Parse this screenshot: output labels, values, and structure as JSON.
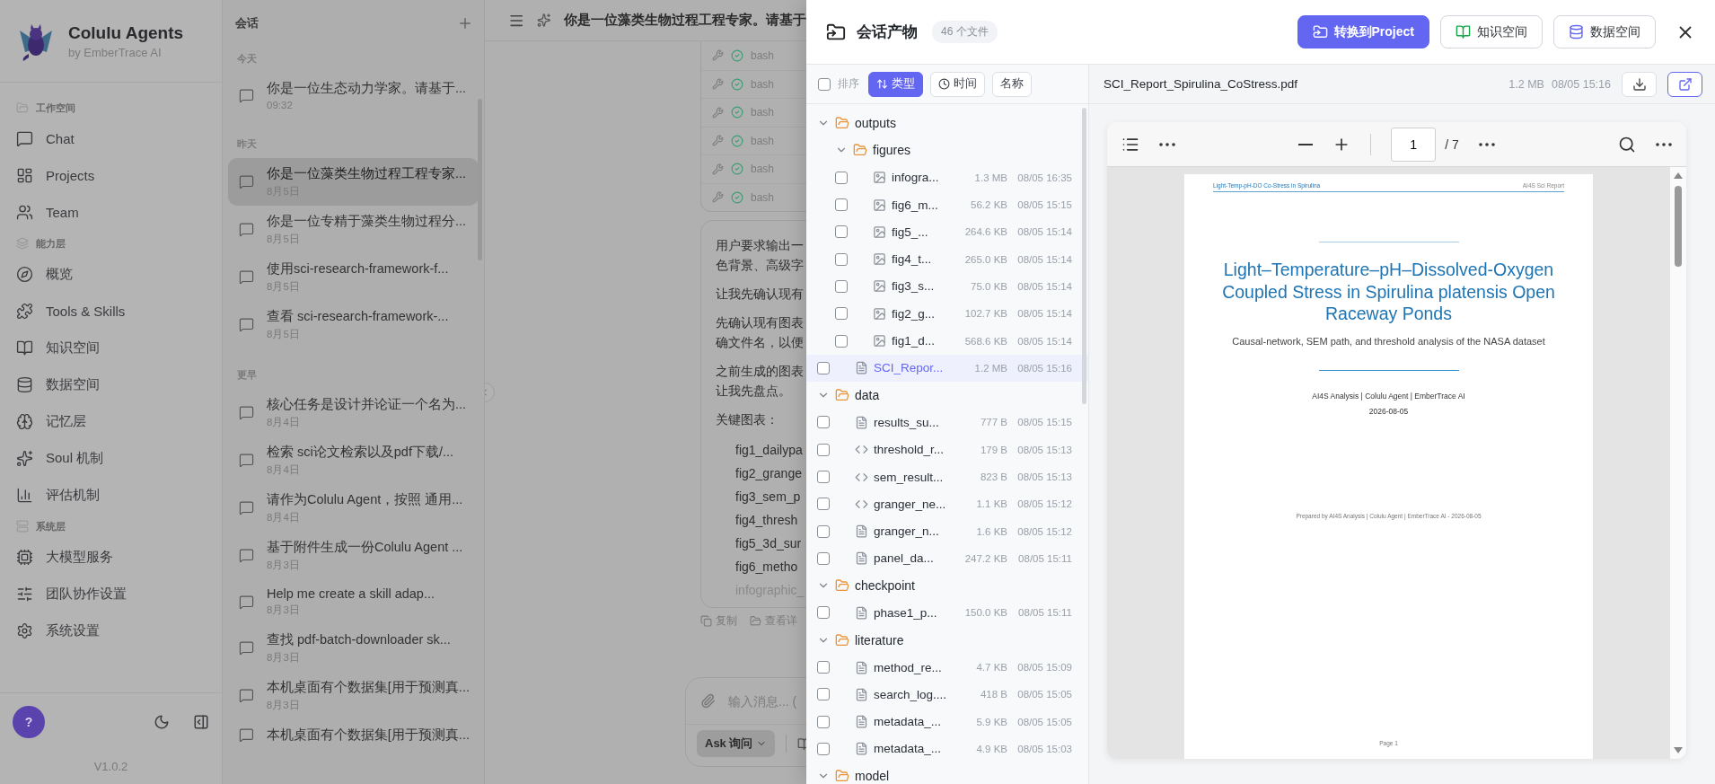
{
  "sidebar": {
    "brand": {
      "name": "Colulu Agents",
      "tagline": "by EmberTrace AI"
    },
    "sections": [
      {
        "label": "工作空间",
        "items": [
          "Chat",
          "Projects",
          "Team"
        ]
      },
      {
        "label": "能力层",
        "items": [
          "概览",
          "Tools & Skills",
          "知识空间",
          "数据空间",
          "记忆层",
          "Soul 机制",
          "评估机制"
        ]
      },
      {
        "label": "系统层",
        "items": [
          "大模型服务",
          "团队协作设置",
          "系统设置"
        ]
      }
    ],
    "help": "?",
    "version": "V1.0.2"
  },
  "conversations": {
    "title": "会话",
    "groups": [
      {
        "label": "今天",
        "items": [
          {
            "title": "你是一位生态动力学家。请基于...",
            "date": "09:32",
            "selected": false
          }
        ]
      },
      {
        "label": "昨天",
        "items": [
          {
            "title": "你是一位藻类生物过程工程专家...",
            "date": "8月5日",
            "selected": true
          },
          {
            "title": "你是一位专精于藻类生物过程分...",
            "date": "8月5日",
            "selected": false
          },
          {
            "title": "使用sci-research-framework-f...",
            "date": "8月5日",
            "selected": false
          },
          {
            "title": "查看 sci-research-framework-...",
            "date": "8月5日",
            "selected": false
          }
        ]
      },
      {
        "label": "更早",
        "items": [
          {
            "title": "核心任务是设计并论证一个名为...",
            "date": "8月4日",
            "selected": false
          },
          {
            "title": "检索 sci论文检索以及pdf下载/...",
            "date": "8月4日",
            "selected": false
          },
          {
            "title": "请作为Colulu Agent，按照 通用...",
            "date": "8月4日",
            "selected": false
          },
          {
            "title": "基于附件生成一份Colulu Agent ...",
            "date": "8月3日",
            "selected": false
          },
          {
            "title": "Help me create a skill adap...",
            "date": "8月3日",
            "selected": false
          },
          {
            "title": "查找 pdf-batch-downloader sk...",
            "date": "8月3日",
            "selected": false
          },
          {
            "title": "本机桌面有个数据集[用于预测真...",
            "date": "8月3日",
            "selected": false
          },
          {
            "title": "本机桌面有个数据集[用于预测真...",
            "selected": false
          }
        ]
      }
    ]
  },
  "chat": {
    "title": "你是一位藻类生物过程工程专家。请基于",
    "tool_calls": [
      {
        "name": "bash",
        "succeeded": true
      },
      {
        "name": "bash",
        "succeeded": true
      },
      {
        "name": "bash",
        "succeeded": true
      },
      {
        "name": "bash",
        "succeeded": true
      },
      {
        "name": "bash",
        "succeeded": true
      },
      {
        "name": "bash",
        "succeeded": true
      }
    ],
    "paragraphs": [
      [
        "用户要求输出一",
        "色背景、高级字"
      ],
      [
        "让我先确认现有"
      ],
      [
        "先确认现有图表",
        "确文件名，以便"
      ],
      [
        "之前生成的图表",
        "让我先盘点。"
      ],
      [
        "关键图表："
      ]
    ],
    "list": [
      "fig1_dailypa",
      "fig2_grange",
      "fig3_sem_p",
      "fig4_thresh",
      "fig5_3d_sur",
      "fig6_metho",
      "infographic_"
    ],
    "actions": [
      "复制",
      "查看详"
    ],
    "input": {
      "placeholder": "输入消息... (",
      "mode": "Ask 询问"
    }
  },
  "artifacts": {
    "title": "会话产物",
    "count": "46 个文件",
    "buttons": [
      {
        "label": "转换到Project",
        "kind": "primary"
      },
      {
        "label": "知识空间",
        "kind": "knowledge"
      },
      {
        "label": "数据空间",
        "kind": "data"
      }
    ],
    "select_all": {
      "checked": false
    },
    "sort_label": "排序",
    "sort_options": [
      {
        "label": "类型",
        "selected": true
      },
      {
        "label": "时间",
        "selected": false
      },
      {
        "label": "名称",
        "selected": false
      }
    ],
    "tree": [
      {
        "kind": "folder",
        "name": "outputs",
        "expanded": true,
        "children": [
          {
            "kind": "folder",
            "name": "figures",
            "expanded": true,
            "children": [
              {
                "kind": "image",
                "name": "infogra...",
                "size": "1.3 MB",
                "time": "08/05 16:35",
                "checked": false,
                "selected": false
              },
              {
                "kind": "image",
                "name": "fig6_m...",
                "size": "56.2 KB",
                "time": "08/05 15:15",
                "checked": false,
                "selected": false
              },
              {
                "kind": "image",
                "name": "fig5_...",
                "size": "264.6 KB",
                "time": "08/05 15:14",
                "checked": false,
                "selected": false
              },
              {
                "kind": "image",
                "name": "fig4_t...",
                "size": "265.0 KB",
                "time": "08/05 15:14",
                "checked": false,
                "selected": false
              },
              {
                "kind": "image",
                "name": "fig3_s...",
                "size": "75.0 KB",
                "time": "08/05 15:14",
                "checked": false,
                "selected": false
              },
              {
                "kind": "image",
                "name": "fig2_g...",
                "size": "102.7 KB",
                "time": "08/05 15:14",
                "checked": false,
                "selected": false
              },
              {
                "kind": "image",
                "name": "fig1_d...",
                "size": "568.6 KB",
                "time": "08/05 15:14",
                "checked": false,
                "selected": false
              }
            ]
          },
          {
            "kind": "document",
            "name": "SCI_Repor...",
            "size": "1.2 MB",
            "time": "08/05 15:16",
            "checked": false,
            "selected": true
          }
        ]
      },
      {
        "kind": "folder",
        "name": "data",
        "expanded": true,
        "children": [
          {
            "kind": "document",
            "name": "results_su...",
            "size": "777 B",
            "time": "08/05 15:15",
            "checked": false,
            "selected": false
          },
          {
            "kind": "code",
            "name": "threshold_r...",
            "size": "179 B",
            "time": "08/05 15:13",
            "checked": false,
            "selected": false
          },
          {
            "kind": "code",
            "name": "sem_result...",
            "size": "823 B",
            "time": "08/05 15:13",
            "checked": false,
            "selected": false
          },
          {
            "kind": "code",
            "name": "granger_ne...",
            "size": "1.1 KB",
            "time": "08/05 15:12",
            "checked": false,
            "selected": false
          },
          {
            "kind": "document",
            "name": "granger_n...",
            "size": "1.6 KB",
            "time": "08/05 15:12",
            "checked": false,
            "selected": false
          },
          {
            "kind": "document",
            "name": "panel_da...",
            "size": "247.2 KB",
            "time": "08/05 15:11",
            "checked": false,
            "selected": false
          }
        ]
      },
      {
        "kind": "folder",
        "name": "checkpoint",
        "expanded": true,
        "children": [
          {
            "kind": "document",
            "name": "phase1_p...",
            "size": "150.0 KB",
            "time": "08/05 15:11",
            "checked": false,
            "selected": false
          }
        ]
      },
      {
        "kind": "folder",
        "name": "literature",
        "expanded": true,
        "children": [
          {
            "kind": "document",
            "name": "method_re...",
            "size": "4.7 KB",
            "time": "08/05 15:09",
            "checked": false,
            "selected": false
          },
          {
            "kind": "document",
            "name": "search_log....",
            "size": "418 B",
            "time": "08/05 15:05",
            "checked": false,
            "selected": false
          },
          {
            "kind": "document",
            "name": "metadata_...",
            "size": "5.9 KB",
            "time": "08/05 15:05",
            "checked": false,
            "selected": false
          },
          {
            "kind": "document",
            "name": "metadata_...",
            "size": "4.9 KB",
            "time": "08/05 15:03",
            "checked": false,
            "selected": false
          }
        ]
      },
      {
        "kind": "folder",
        "name": "model",
        "expanded": true
      }
    ],
    "preview": {
      "file": "SCI_Report_Spirulina_CoStress.pdf",
      "size": "1.2 MB",
      "time": "08/05 15:16",
      "page": "1",
      "total": "/ 7",
      "document": {
        "running_title": "Light-Temp-pH-DO Co-Stress in Spirulina",
        "series": "AI4S Sci Report",
        "title": "Light–Temperature–pH–Dissolved-Oxygen Coupled Stress in Spirulina platensis Open Raceway Ponds",
        "subtitle": "Causal-network, SEM path, and threshold analysis of the NASA dataset",
        "authors": "AI4S Analysis | Colulu Agent | EmberTrace AI",
        "date": "2026-08-05",
        "prepared": "Prepared by AI4S Analysis | Colulu Agent | EmberTrace AI - 2026-08-05",
        "footer": "Page 1"
      }
    }
  }
}
